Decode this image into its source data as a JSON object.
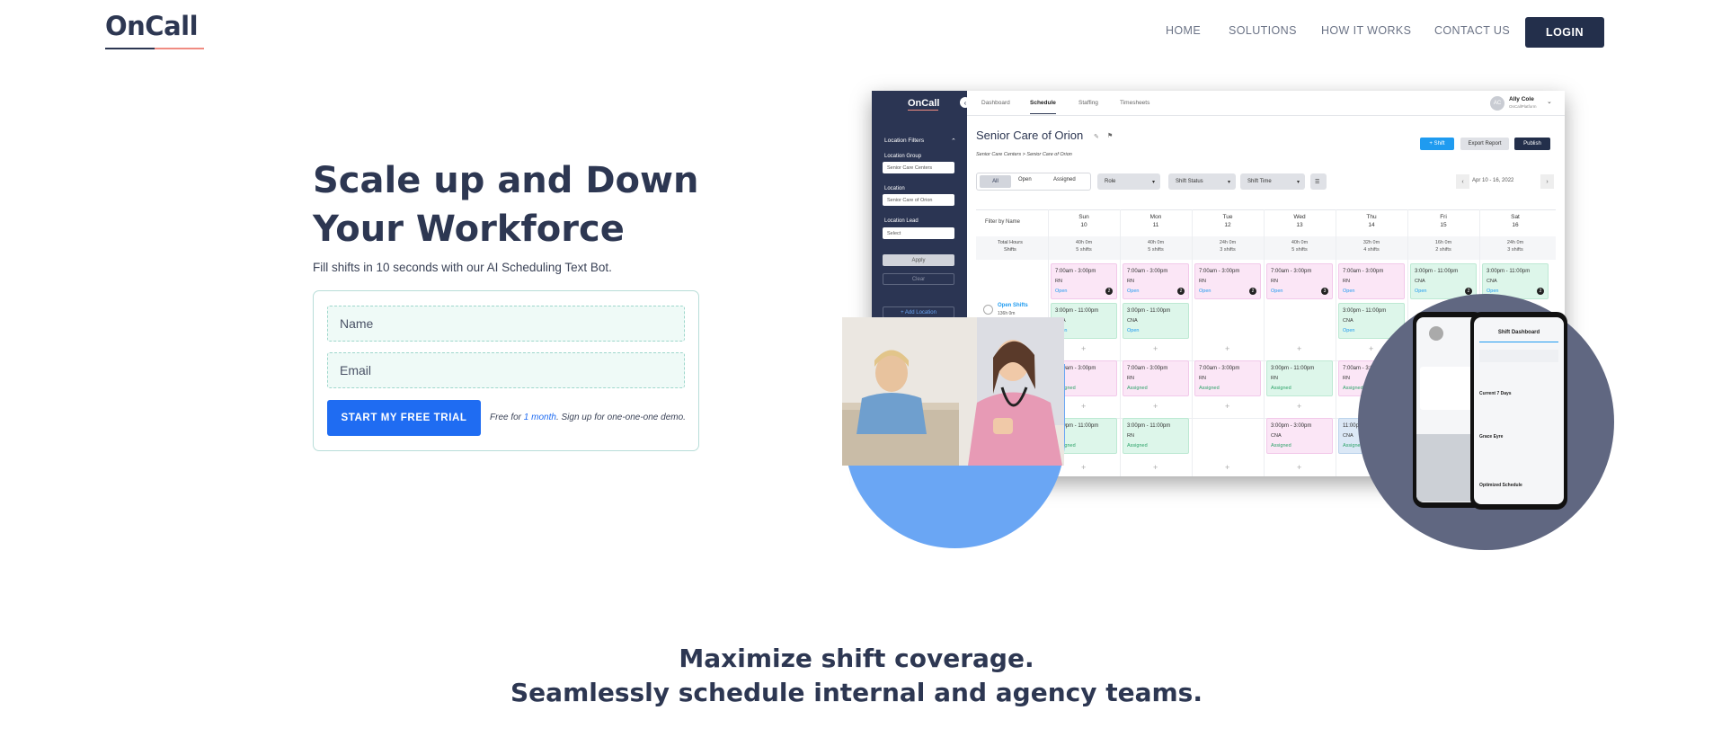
{
  "header": {
    "logo": "OnCall",
    "nav": [
      "HOME",
      "SOLUTIONS",
      "HOW IT WORKS",
      "CONTACT US"
    ],
    "login_label": "LOGIN"
  },
  "hero": {
    "title_line1": "Scale up and Down",
    "title_line2": "Your Workforce",
    "subtitle": "Fill shifts in 10 seconds with our AI Scheduling Text Bot.",
    "form": {
      "name_placeholder": "Name",
      "email_placeholder": "Email",
      "cta_label": "START MY FREE TRIAL",
      "note_pre": "Free for ",
      "note_link": "1 month",
      "note_post": ". Sign up for one-one-one demo."
    }
  },
  "app_preview": {
    "brand": "OnCall",
    "tabs": [
      "Dashboard",
      "Schedule",
      "Staffing",
      "Timesheets"
    ],
    "user_initials": "AC",
    "user_name": "Ally Cole",
    "user_org": "OnCallPlatform",
    "sidebar": {
      "filters_title": "Location Filters",
      "group_label": "Location Group",
      "group_value": "Senior Care Centers",
      "location_label": "Location",
      "location_value": "Senior Care of Orion",
      "lead_label": "Location Lead",
      "lead_value": "Select",
      "apply": "Apply",
      "clear": "Clear",
      "add_location": "+ Add Location"
    },
    "location_title": "Senior Care of Orion",
    "breadcrumb": "Senior Care Centers > Senior Care of Orion",
    "actions": {
      "shift": "+ Shift",
      "export": "Export Report",
      "publish": "Publish"
    },
    "filters": {
      "all": "All",
      "open": "Open",
      "assigned": "Assigned",
      "role": "Role",
      "status": "Shift Status",
      "time": "Shift Time"
    },
    "date_range": "Apr 10 - 16, 2022",
    "filter_by_name": "Filter by Name",
    "total_hours": "Total Hours",
    "shifts_label": "Shifts",
    "open_shifts_label": "Open Shifts",
    "open_shifts_hours": "136h 0m",
    "days": [
      {
        "d": "Sun",
        "n": "10",
        "h": "40h 0m",
        "s": "5 shifts"
      },
      {
        "d": "Mon",
        "n": "11",
        "h": "40h 0m",
        "s": "5 shifts"
      },
      {
        "d": "Tue",
        "n": "12",
        "h": "24h 0m",
        "s": "3 shifts"
      },
      {
        "d": "Wed",
        "n": "13",
        "h": "40h 0m",
        "s": "5 shifts"
      },
      {
        "d": "Thu",
        "n": "14",
        "h": "32h 0m",
        "s": "4 shifts"
      },
      {
        "d": "Fri",
        "n": "15",
        "h": "16h 0m",
        "s": "2 shifts"
      },
      {
        "d": "Sat",
        "n": "16",
        "h": "24h 0m",
        "s": "3 shifts"
      }
    ],
    "row1": [
      {
        "t": "7:00am - 3:00pm",
        "r": "RN",
        "s": "Open",
        "c": "pink",
        "b": "2"
      },
      {
        "t": "7:00am - 3:00pm",
        "r": "RN",
        "s": "Open",
        "c": "pink",
        "b": "2"
      },
      {
        "t": "7:00am - 3:00pm",
        "r": "RN",
        "s": "Open",
        "c": "pink",
        "b": "2"
      },
      {
        "t": "7:00am - 3:00pm",
        "r": "RN",
        "s": "Open",
        "c": "pink",
        "b": "3"
      },
      {
        "t": "7:00am - 3:00pm",
        "r": "RN",
        "s": "Open",
        "c": "pink",
        "b": ""
      },
      {
        "t": "3:00pm - 11:00pm",
        "r": "CNA",
        "s": "Open",
        "c": "green",
        "b": "2"
      },
      {
        "t": "3:00pm - 11:00pm",
        "r": "CNA",
        "s": "Open",
        "c": "green",
        "b": "2"
      }
    ],
    "row2": [
      {
        "t": "3:00pm - 11:00pm",
        "r": "CNA",
        "s": "Open",
        "c": "green",
        "col": 0
      },
      {
        "t": "3:00pm - 11:00pm",
        "r": "CNA",
        "s": "Open",
        "c": "green",
        "col": 1
      },
      {
        "t": "3:00pm - 11:00pm",
        "r": "CNA",
        "s": "Open",
        "c": "green",
        "col": 4
      }
    ],
    "row3": [
      {
        "t": "7:00am - 3:00pm",
        "r": "RN",
        "s": "Assigned",
        "c": "pink",
        "col": 0
      },
      {
        "t": "7:00am - 3:00pm",
        "r": "RN",
        "s": "Assigned",
        "c": "pink",
        "col": 1
      },
      {
        "t": "7:00am - 3:00pm",
        "r": "RN",
        "s": "Assigned",
        "c": "pink",
        "col": 2
      },
      {
        "t": "3:00pm - 11:00pm",
        "r": "RN",
        "s": "Assigned",
        "c": "green",
        "col": 3
      },
      {
        "t": "7:00am - 3:00pm",
        "r": "RN",
        "s": "Assigned",
        "c": "pink",
        "col": 4
      }
    ],
    "row4": [
      {
        "t": "3:00pm - 11:00pm",
        "r": "RN",
        "s": "Assigned",
        "c": "green",
        "col": 0
      },
      {
        "t": "3:00pm - 11:00pm",
        "r": "RN",
        "s": "Assigned",
        "c": "green",
        "col": 1
      },
      {
        "t": "3:00pm - 3:00pm",
        "r": "CNA",
        "s": "Assigned",
        "c": "pink",
        "col": 3
      },
      {
        "t": "11:00pm - 7:00am",
        "r": "CNA",
        "s": "Assigned",
        "c": "blue",
        "col": 4
      }
    ]
  },
  "phone": {
    "title": "Shift Dashboard",
    "section1": "Current 7 Days",
    "section2": "Grace Eyre",
    "section3": "Optimized Schedule"
  },
  "section": {
    "line1": "Maximize shift coverage.",
    "line2": "Seamlessly schedule internal and agency teams."
  },
  "colors": {
    "primary": "#1f6cf2",
    "navy": "#2d3752",
    "accent": "#f08c82",
    "circle_blue": "#6aa6f4",
    "circle_dark": "#606781"
  }
}
